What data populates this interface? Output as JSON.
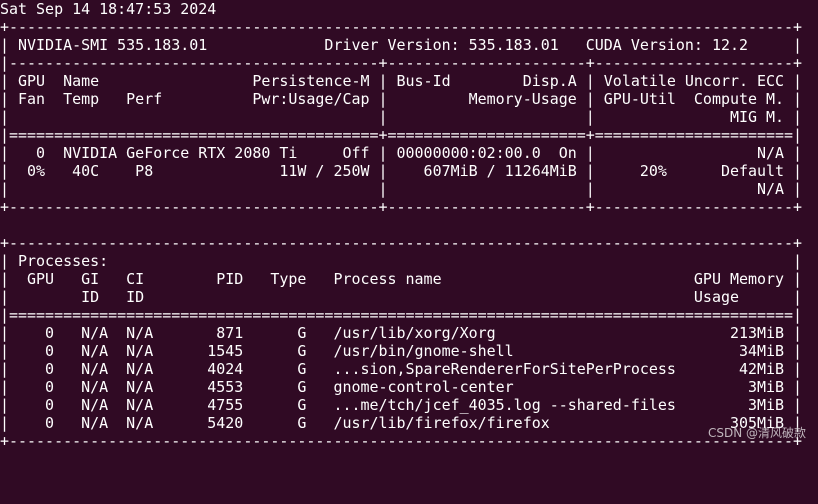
{
  "terminal": {
    "background": "#300a24",
    "foreground": "#ffffff",
    "lines": [
      "Sat Sep 14 18:47:53 2024",
      "+---------------------------------------------------------------------------------------+",
      "| NVIDIA-SMI 535.183.01             Driver Version: 535.183.01   CUDA Version: 12.2     |",
      "|-----------------------------------------+----------------------+----------------------+",
      "| GPU  Name                 Persistence-M | Bus-Id        Disp.A | Volatile Uncorr. ECC |",
      "| Fan  Temp   Perf          Pwr:Usage/Cap |         Memory-Usage | GPU-Util  Compute M. |",
      "|                                         |                      |               MIG M. |",
      "|=========================================+======================+======================|",
      "|   0  NVIDIA GeForce RTX 2080 Ti     Off | 00000000:02:00.0  On |                  N/A |",
      "|  0%   40C    P8              11W / 250W |    607MiB / 11264MiB |     20%      Default |",
      "|                                         |                      |                  N/A |",
      "+-----------------------------------------+----------------------+----------------------+",
      "",
      "+---------------------------------------------------------------------------------------+",
      "| Processes:                                                                            |",
      "|  GPU   GI   CI        PID   Type   Process name                            GPU Memory |",
      "|        ID   ID                                                             Usage      |",
      "|=======================================================================================|",
      "|    0   N/A  N/A       871      G   /usr/lib/xorg/Xorg                          213MiB |",
      "|    0   N/A  N/A      1545      G   /usr/bin/gnome-shell                         34MiB |",
      "|    0   N/A  N/A      4024      G   ...sion,SpareRendererForSitePerProcess       42MiB |",
      "|    0   N/A  N/A      4553      G   gnome-control-center                          3MiB |",
      "|    0   N/A  N/A      4755      G   ...me/tch/jcef_4035.log --shared-files        3MiB |",
      "|    0   N/A  N/A      5420      G   /usr/lib/firefox/firefox                    305MiB |",
      "+---------------------------------------------------------------------------------------+"
    ]
  },
  "watermark": "CSDN @清风破款"
}
